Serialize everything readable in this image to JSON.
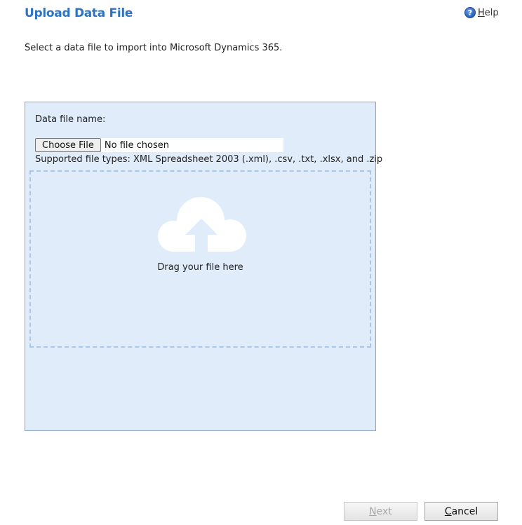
{
  "header": {
    "title": "Upload Data File",
    "help": {
      "accesskey": "H",
      "rest": "elp",
      "icon": "help-question-icon"
    }
  },
  "intro_text": "Select a data file to import into Microsoft Dynamics 365.",
  "upload": {
    "field_label": "Data file name:",
    "choose_file_label": "Choose File",
    "file_status": "No file chosen",
    "supported_types": "Supported file types: XML Spreadsheet 2003 (.xml), .csv, .txt, .xlsx, and .zip",
    "dropzone": {
      "icon": "cloud-upload-icon",
      "text": "Drag your file here"
    }
  },
  "footer": {
    "next": {
      "accesskey": "N",
      "rest": "ext",
      "enabled": false
    },
    "cancel": {
      "accesskey": "C",
      "rest": "ancel",
      "enabled": true
    }
  },
  "colors": {
    "title": "#2d73c0",
    "panel_background": "#e1ecfb",
    "panel_border": "#8aa6c6",
    "dropzone_border": "#a9c7e8",
    "disabled_text": "#a8a8a8"
  }
}
